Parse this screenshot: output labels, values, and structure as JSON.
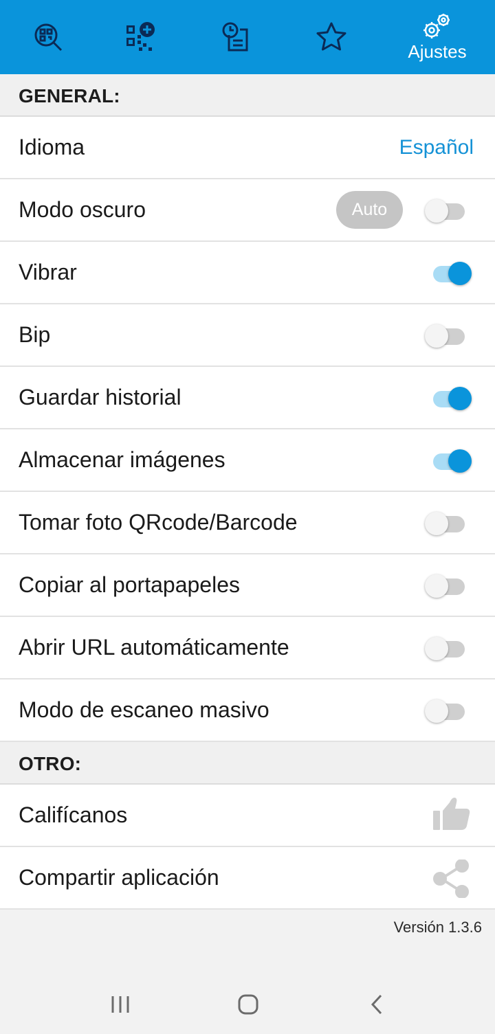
{
  "tabs": [
    {
      "name": "scan",
      "icon": "qr-scan-search-icon"
    },
    {
      "name": "create",
      "icon": "qr-add-icon"
    },
    {
      "name": "history",
      "icon": "history-document-icon"
    },
    {
      "name": "favorites",
      "icon": "star-icon"
    },
    {
      "name": "settings",
      "icon": "gear-icon",
      "label": "Ajustes",
      "active": true
    }
  ],
  "sections": {
    "general": "GENERAL:",
    "other": "OTRO:"
  },
  "settings": {
    "language": {
      "label": "Idioma",
      "value": "Español"
    },
    "dark_mode": {
      "label": "Modo oscuro",
      "auto_label": "Auto",
      "on": false
    },
    "vibrate": {
      "label": "Vibrar",
      "on": true
    },
    "beep": {
      "label": "Bip",
      "on": false
    },
    "save_history": {
      "label": "Guardar historial",
      "on": true
    },
    "store_images": {
      "label": "Almacenar imágenes",
      "on": true
    },
    "take_photo": {
      "label": "Tomar foto QRcode/Barcode",
      "on": false
    },
    "copy_clipboard": {
      "label": "Copiar al portapapeles",
      "on": false
    },
    "open_url": {
      "label": "Abrir URL automáticamente",
      "on": false
    },
    "bulk_scan": {
      "label": "Modo de escaneo masivo",
      "on": false
    }
  },
  "other": {
    "rate": {
      "label": "Califícanos",
      "icon": "thumbs-up-icon"
    },
    "share": {
      "label": "Compartir aplicación",
      "icon": "share-icon"
    }
  },
  "version": "Versión 1.3.6",
  "colors": {
    "accent": "#0a94db",
    "switch_on_track": "#a9dcf5",
    "switch_off_track": "#cfcfcf"
  },
  "navbar": [
    {
      "name": "recents",
      "icon": "recents-icon"
    },
    {
      "name": "home",
      "icon": "home-icon"
    },
    {
      "name": "back",
      "icon": "back-icon"
    }
  ]
}
